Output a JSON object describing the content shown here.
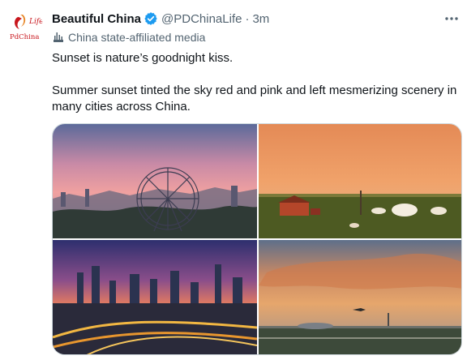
{
  "tweet": {
    "author_name": "Beautiful China",
    "handle": "@PDChinaLife",
    "separator": "·",
    "time": "3m",
    "affiliation": "China state-affiliated media",
    "text_line1": "Sunset is nature’s goodnight kiss.",
    "text_para2": "Summer sunset tinted the sky red and pink and left mesmerizing scenery in many cities across China."
  },
  "avatar": {
    "logo_text_top": "Life",
    "logo_text_bottom": "PdChina"
  },
  "icons": {
    "verified": "verified-badge-icon",
    "more": "more-options-icon",
    "affiliation": "flag-icon"
  },
  "colors": {
    "verified_blue": "#1d9bf0",
    "secondary_text": "#536471",
    "logo_red": "#c8161d",
    "logo_orange": "#e8882b"
  },
  "media": [
    {
      "id": "photo-ferris-wheel",
      "scene": "ferris-wheel-city-sunset"
    },
    {
      "id": "photo-grassland-yurts",
      "scene": "grassland-yurts-sunset"
    },
    {
      "id": "photo-skyline-highway",
      "scene": "city-skyline-highway-dusk"
    },
    {
      "id": "photo-airport-plane",
      "scene": "airport-plane-sunset"
    }
  ]
}
